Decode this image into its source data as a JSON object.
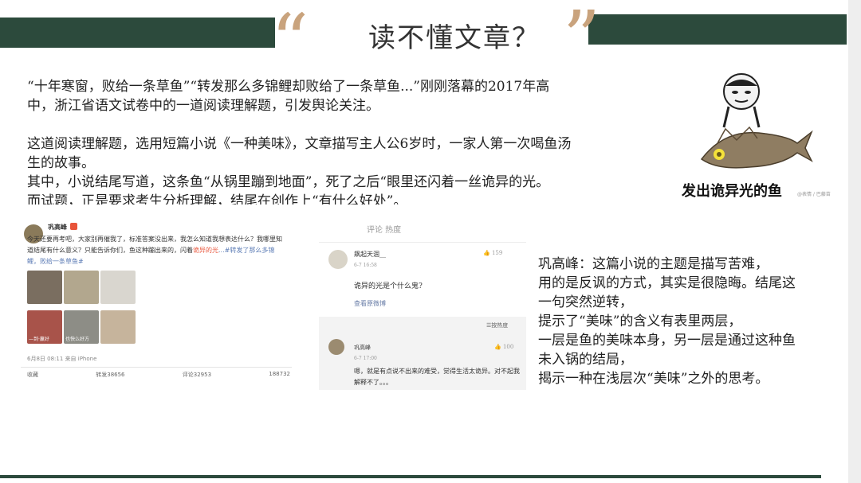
{
  "header": {
    "title": "读不懂文章？",
    "open_quote": "“",
    "close_quote": "”"
  },
  "body_paragraphs": [
    "“十年寒窗，败给一条草鱼”“转发那么多锦鲤却败给了一条草鱼...”刚刚落幕的2017年高",
    "中，浙江省语文试卷中的一道阅读理解题，引发舆论关注。",
    "",
    "这道阅读理解题，选用短篇小说《一种美味》，文章描写主人公6岁时，一家人第一次喝鱼汤",
    "生的故事。",
    "其中，小说结尾写道，这条鱼“从锅里蹦到地面”，死了之后“眼里还闪着一丝诡异的光。",
    "而试题，正是要求考生分析理解，结尾在创作上“有什么好处”。"
  ],
  "meme": {
    "caption": "发出诡异光的鱼",
    "watermark": "@表情 / 巴藤苗"
  },
  "weibo": {
    "username": "巩高峰",
    "post_plain": "今天还要再考吧，大家别再催我了，标准答案没出来，我怎么知道我想表达什么？我哪里知道结尾有什么意义？只能告诉你们，鱼这种蹦出来的，闪着",
    "post_red": "诡异的光",
    "post_blue": "...#转发了那么多锦鲤，败给一条草鱼#",
    "thumb_labels": [
      "",
      "",
      "",
      "—到·赢好",
      "也快么好方",
      ""
    ],
    "meta": "6月8日 08:11 来自 iPhone",
    "actions": [
      "收藏",
      "转发38656",
      "评论32953",
      "188732"
    ]
  },
  "comments": {
    "cut_header": "评论 热度",
    "c1_name": "飙起天涸__",
    "c1_time": "6-7 16:58",
    "c1_likes": "159",
    "c1_text": "诡异的光是个什么鬼?",
    "c1_source": "查看原微博",
    "sort_label": "按热度",
    "c2_name": "巩高峰",
    "c2_time": "6-7 17:00",
    "c2_likes": "100",
    "c2_text": "嗯，就是有点说不出来的难受，觉得生活太诡异。对不起我解释不了。。。"
  },
  "commentary_lines": [
    "巩高峰：这篇小说的主题是描写苦难，",
    "用的是反讽的方式，其实是很隐晦。结尾这",
    "一句突然逆转，",
    "提示了“美味”的含义有表里两层，",
    "一层是鱼的美味本身，另一层是通过这种鱼",
    "未入锅的结局，",
    "揭示一种在浅层次“美味”之外的思考。"
  ],
  "colors": {
    "bar": "#2c4a3c",
    "quote": "#c9a37d",
    "red_link": "#e8543a",
    "blue_link": "#5b7bb5"
  }
}
